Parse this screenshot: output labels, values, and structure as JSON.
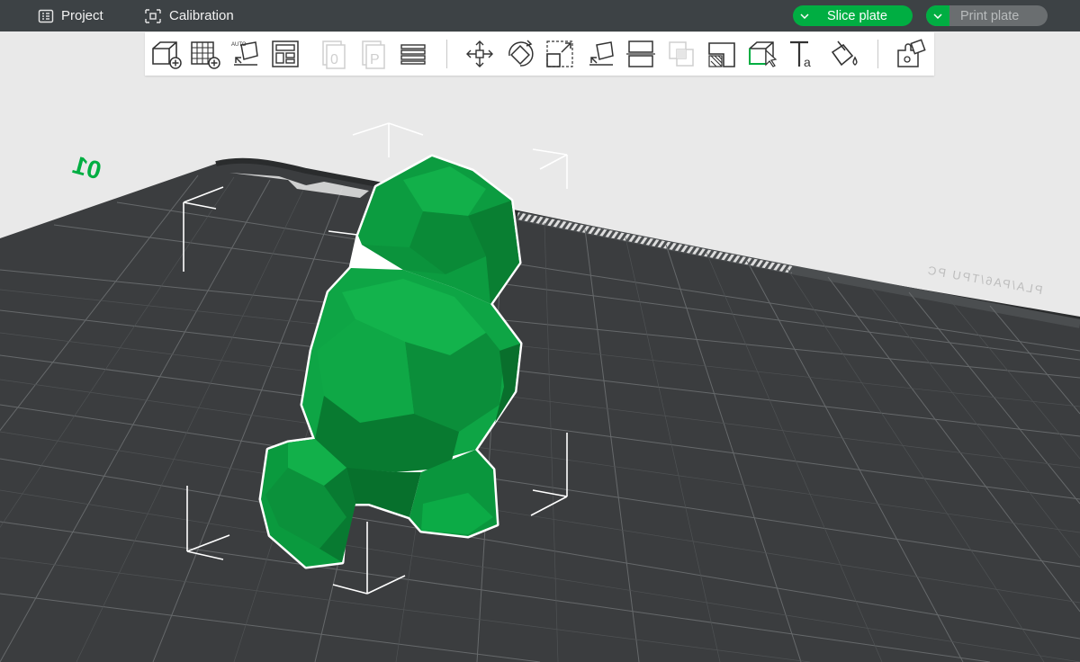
{
  "topbar": {
    "project_label": "Project",
    "calibration_label": "Calibration",
    "slice_label": "Slice plate",
    "print_label": "Print plate",
    "accent": "#00ae42",
    "bar_color": "#3d4245"
  },
  "toolbar": {
    "buttons": [
      {
        "name": "add-object-icon",
        "enabled": true
      },
      {
        "name": "add-plate-icon",
        "enabled": true
      },
      {
        "name": "auto-orient-icon",
        "enabled": true
      },
      {
        "name": "arrange-icon",
        "enabled": true
      },
      {
        "name": "split-to-objects-icon",
        "enabled": false
      },
      {
        "name": "split-to-parts-icon",
        "enabled": false
      },
      {
        "name": "layers-icon",
        "enabled": true
      },
      {
        "name": "move-icon",
        "enabled": true
      },
      {
        "name": "rotate-icon",
        "enabled": true
      },
      {
        "name": "scale-icon",
        "enabled": true
      },
      {
        "name": "lay-on-face-icon",
        "enabled": true
      },
      {
        "name": "cut-icon",
        "enabled": true
      },
      {
        "name": "boolean-icon",
        "enabled": false
      },
      {
        "name": "support-painting-icon",
        "enabled": true
      },
      {
        "name": "seam-painting-icon",
        "enabled": true
      },
      {
        "name": "text-emboss-icon",
        "enabled": true
      },
      {
        "name": "color-painting-icon",
        "enabled": true
      },
      {
        "name": "assembly-icon",
        "enabled": true
      }
    ]
  },
  "plate": {
    "number_label": "01",
    "edge_text": "PLA/PA6/TPU PC",
    "plate_color": "#3b3d3f",
    "grid_color": "#6b6e70",
    "model_color": "#0a9a3e"
  }
}
